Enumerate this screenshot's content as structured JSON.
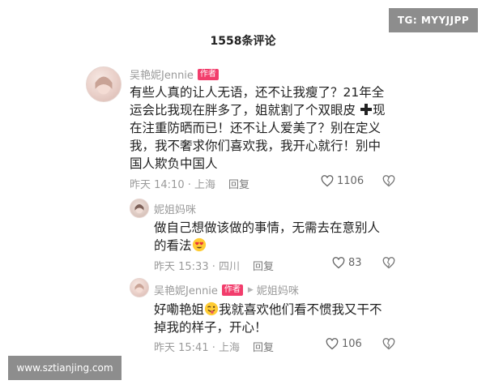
{
  "watermarks": {
    "top_right": "TG: MYYJJPP",
    "bottom_left": "www.sztianjing.com"
  },
  "header": {
    "title": "1558条评论"
  },
  "comments": [
    {
      "author": "吴艳妮Jennie",
      "badge": "作者",
      "lines": [
        "有些人真的让人无语，还不让我瘦了？21年全",
        "运会比我现在胖多了，姐就割了个双眼皮",
        "现",
        "在注重防晒而已！还不让人爱美了？别在定义",
        "我，我不奢求你们喜欢我，我开心就行！别中",
        "国人欺负中国人"
      ],
      "time": "昨天 14:10 · 上海",
      "reply_label": "回复",
      "likes": "1106"
    },
    {
      "author": "妮姐妈咪",
      "lines": [
        "做自己想做该做的事情，无需去在意别人",
        "的看法"
      ],
      "time": "昨天 15:33 · 四川",
      "reply_label": "回复",
      "likes": "83"
    },
    {
      "author": "吴艳妮Jennie",
      "badge": "作者",
      "reply_to": "妮姐妈咪",
      "lines": [
        "好嘞艳姐",
        "我就喜欢他们看不惯我又干不",
        "掉我的样子，开心！"
      ],
      "time": "昨天 15:41 · 上海",
      "reply_label": "回复",
      "likes": "106"
    }
  ],
  "icons": {
    "heart": "heart-outline-icon",
    "dislike": "broken-heart-icon",
    "plus": "plus-icon",
    "heart_eyes": "heart-eyes-emoji",
    "wink_tongue": "winking-tongue-emoji"
  },
  "colors": {
    "badge": "#f23d6c",
    "meta_text": "#9a9a9a",
    "body_text": "#1f1f1f",
    "watermark_bg": "#8d8d8d"
  }
}
